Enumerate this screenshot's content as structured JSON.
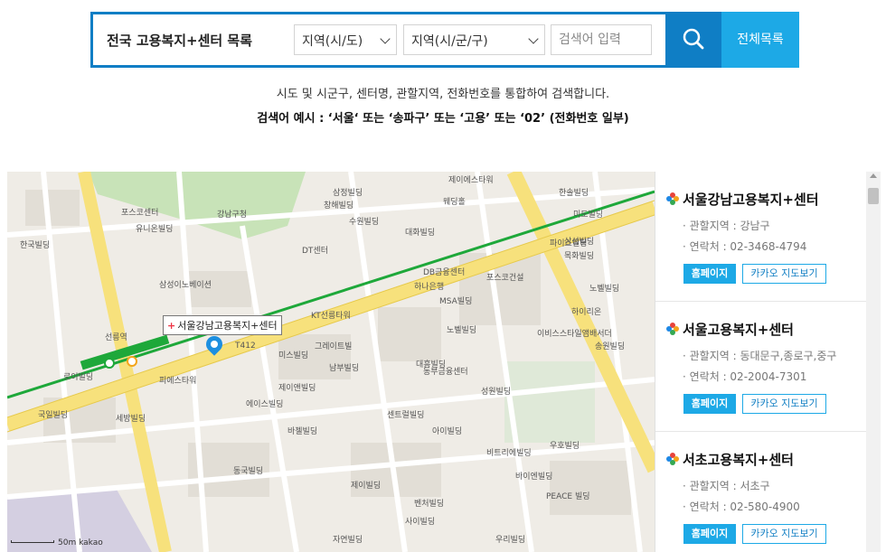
{
  "search": {
    "title": "전국 고용복지+센터 목록",
    "city_select": "지역(시/도)",
    "district_select": "지역(시/군/구)",
    "keyword_placeholder": "검색어 입력",
    "list_all_label": "전체목록"
  },
  "description": {
    "line1": "시도 및 시군구, 센터명, 관할지역, 전화번호를 통합하여 검색합니다.",
    "line2": "검색어 예시 : ‘서울‘ 또는 ‘송파구’ 또는 ‘고용’ 또는 ‘02’ (전화번호 일부)"
  },
  "map": {
    "tooltip": "서울강남고용복지+센터",
    "attribution": "kakao",
    "scale": "50m",
    "labels": [
      "제이에스타워",
      "삼정빌딩",
      "창해빌딩",
      "수원빌딩",
      "대화빌딩",
      "웨딩홀",
      "포스코건설",
      "DB금융센터",
      "MSA빌딩",
      "노벨빌딩",
      "포스코센터",
      "유니온빌딩",
      "강남구청",
      "대흥빌딩",
      "KT선릉타워",
      "미스빌딩",
      "그레이트빌",
      "하나은행",
      "이비스스타일앰배서더",
      "송원빌딩",
      "동부금융센터",
      "비트리에빌딩",
      "파이스빌딩",
      "피에스타워",
      "삼성이노베이션",
      "세방빌딩",
      "남부빌딩",
      "PEACE 빌딩",
      "선릉역",
      "로이빌딩",
      "T412",
      "제이앤빌딩",
      "동국빌딩",
      "바젤빌딩",
      "제이빌딩",
      "성원빌딩",
      "벤처빌딩",
      "바이엔빌딩",
      "우리빌딩",
      "자연빌딩",
      "아이빌딩",
      "삼성빌딩",
      "노벨빌딩",
      "미도빌딩",
      "센트럴빌딩",
      "사이빌딩",
      "한솔빌딩",
      "우호빌딩",
      "국일빌딩",
      "하이리온",
      "DT센터",
      "목화빌딩",
      "한국빌딩",
      "에이스빌딩"
    ]
  },
  "centers": [
    {
      "name": "서울강남고용복지+센터",
      "area": "· 관할지역 : 강남구",
      "phone": "· 연락처 : 02-3468-4794",
      "home_label": "홈페이지",
      "kakao_label": "카카오 지도보기"
    },
    {
      "name": "서울고용복지+센터",
      "area": "· 관할지역 : 동대문구,종로구,중구",
      "phone": "· 연락처 : 02-2004-7301",
      "home_label": "홈페이지",
      "kakao_label": "카카오 지도보기"
    },
    {
      "name": "서초고용복지+센터",
      "area": "· 관할지역 : 서초구",
      "phone": "· 연락처 : 02-580-4900",
      "home_label": "홈페이지",
      "kakao_label": "카카오 지도보기"
    }
  ],
  "colors": {
    "primary": "#0f7ec5",
    "accent": "#1da9e6",
    "road_yellow": "#f7e17c",
    "line2_green": "#1ea83a"
  }
}
